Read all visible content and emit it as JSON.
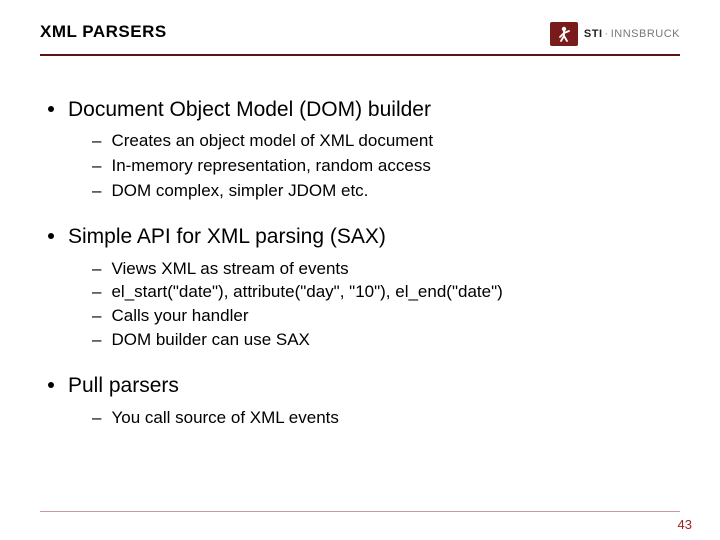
{
  "header": {
    "title": "XML PARSERS",
    "logo": {
      "sti": "STI",
      "sep": "·",
      "inns": "INNSBRUCK"
    }
  },
  "bullets": [
    {
      "text": "Document Object Model (DOM) builder",
      "subs": [
        "Creates an object model of XML document",
        "In-memory representation, random access",
        "DOM complex, simpler JDOM etc."
      ]
    },
    {
      "text": "Simple API for XML parsing (SAX)",
      "subs": [
        "Views XML as stream of events",
        "el_start(\"date\"), attribute(\"day\", \"10\"), el_end(\"date\")",
        "Calls your handler",
        "DOM builder can use SAX"
      ]
    },
    {
      "text": "Pull parsers",
      "subs": [
        "You call source of XML events"
      ]
    }
  ],
  "page_number": "43"
}
